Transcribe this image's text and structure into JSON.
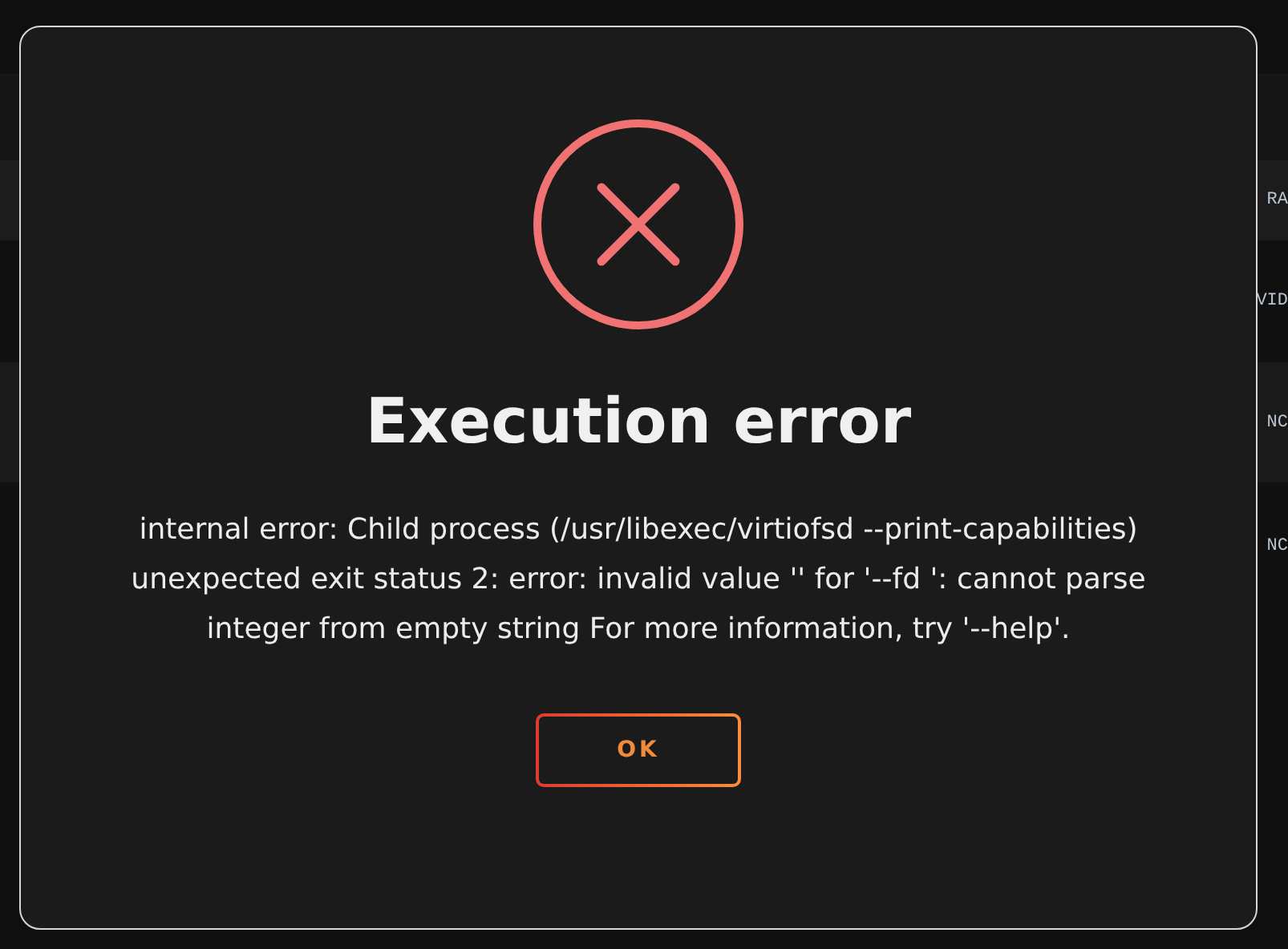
{
  "background_table": {
    "header": {
      "column_cut": "RA"
    },
    "rows": [
      {
        "column_cut": "VID"
      },
      {
        "column_cut": "NC"
      },
      {
        "column_cut": "NC"
      }
    ]
  },
  "dialog": {
    "title": "Execution error",
    "message": "internal error: Child process (/usr/libexec/virtiofsd --print-capabilities) unexpected exit status 2: error: invalid value '' for '--fd ': cannot parse integer from empty string For more information, try '--help'.",
    "buttons": [
      "OK"
    ]
  }
}
